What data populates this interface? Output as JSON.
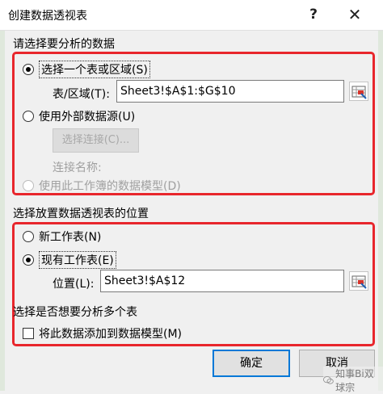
{
  "window": {
    "title": "创建数据透视表",
    "help": "?",
    "close": "✕"
  },
  "section1": {
    "heading": "请选择要分析的数据",
    "option_table": "选择一个表或区域(S)",
    "table_range_label": "表/区域(T):",
    "table_range_value": "Sheet3!$A$1:$G$10",
    "option_external": "使用外部数据源(U)",
    "choose_connection": "选择连接(C)...",
    "connection_name_label": "连接名称:",
    "option_datamodel": "使用此工作簿的数据模型(D)"
  },
  "section2": {
    "heading": "选择放置数据透视表的位置",
    "option_new": "新工作表(N)",
    "option_existing": "现有工作表(E)",
    "location_label": "位置(L):",
    "location_value": "Sheet3!$A$12"
  },
  "section3": {
    "heading": "选择是否想要分析多个表",
    "add_to_model": "将此数据添加到数据模型(M)"
  },
  "buttons": {
    "ok": "确定",
    "cancel": "取消"
  },
  "watermark": "知事Bi双球宗",
  "colors": {
    "highlight": "#e8262c",
    "focus": "#0078d7"
  },
  "state": {
    "selected_source": "table_range",
    "selected_location": "existing",
    "add_to_model_checked": false
  }
}
